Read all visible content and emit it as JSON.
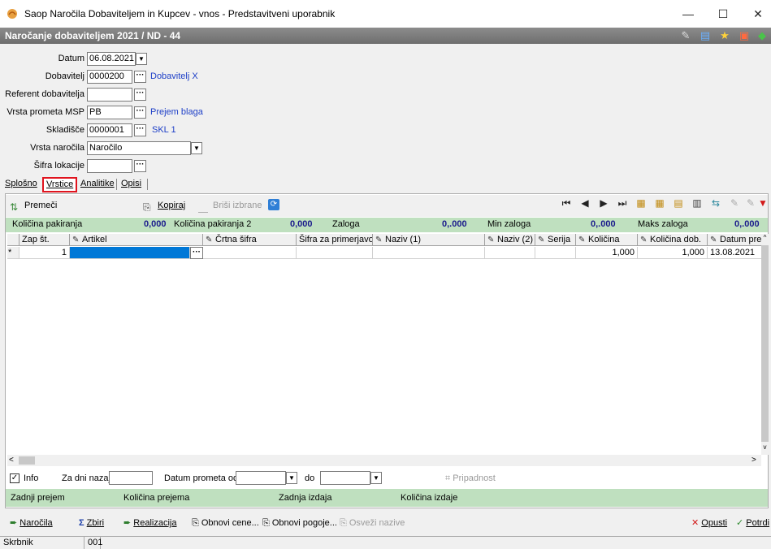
{
  "window": {
    "title": "Saop  Naročila Dobaviteljem in Kupcev - vnos - Predstavitveni uporabnik",
    "minimize": "—",
    "maximize": "☐",
    "close": "✕"
  },
  "header": {
    "title": "Naročanje dobaviteljem 2021 / ND - 44"
  },
  "form": {
    "datum_label": "Datum",
    "datum_value": "06.08.2021",
    "dobavitelj_label": "Dobavitelj",
    "dobavitelj_value": "0000200",
    "dobavitelj_name": "Dobavitelj X",
    "referent_label": "Referent dobavitelja",
    "referent_value": "",
    "vrsta_prometa_label": "Vrsta prometa MSP",
    "vrsta_prometa_value": "PB",
    "vrsta_prometa_name": "Prejem blaga",
    "skladisce_label": "Skladišče",
    "skladisce_value": "0000001",
    "skladisce_name": "SKL 1",
    "vrsta_narocila_label": "Vrsta naročila",
    "vrsta_narocila_value": "Naročilo",
    "sifra_lokacije_label": "Šifra lokacije",
    "sifra_lokacije_value": ""
  },
  "tabs": [
    {
      "label": "Splošno"
    },
    {
      "label": "Vrstice"
    },
    {
      "label": "Analitike"
    },
    {
      "label": "Opisi"
    }
  ],
  "toolbar": {
    "premeci": "Premeči",
    "kopiraj": "Kopiraj",
    "brisi": "Briši izbrane"
  },
  "stats": {
    "kolicina_pakiranja_label": "Količina pakiranja",
    "kolicina_pakiranja_value": "0,000",
    "kolicina_pakiranja2_label": "Količina pakiranja 2",
    "kolicina_pakiranja2_value": "0,000",
    "zaloga_label": "Zaloga",
    "zaloga_value": "0,.000",
    "min_zaloga_label": "Min zaloga",
    "min_zaloga_value": "0,.000",
    "maks_zaloga_label": "Maks zaloga",
    "maks_zaloga_value": "0,.000"
  },
  "grid": {
    "columns": [
      "Zap št.",
      "Artikel",
      "Črtna šifra",
      "Šifra za primerjavo",
      "Naziv (1)",
      "Naziv (2)",
      "Serija",
      "Količina",
      "Količina dob.",
      "Datum pre"
    ],
    "row": {
      "marker": "*",
      "zap": "1",
      "artikel": "",
      "crtna": "",
      "sifra_prim": "",
      "naziv1": "",
      "naziv2": "",
      "serija": "",
      "kolicina": "1,000",
      "kolicina_dob": "1,000",
      "datum": "13.08.2021"
    }
  },
  "filters": {
    "info_label": "Info",
    "info_checked": "✓",
    "za_dni_label": "Za dni nazaj",
    "datum_od_label": "Datum prometa od",
    "do_label": "do",
    "pripadnost": "Pripadnost"
  },
  "green2": {
    "zadnji_prejem": "Zadnji prejem",
    "kolicina_prejema": "Količina prejema",
    "zadnja_izdaja": "Zadnja izdaja",
    "kolicina_izdaje": "Količina izdaje"
  },
  "buttons": {
    "narocila": "Naročila",
    "zbiri": "Zbiri",
    "realizacija": "Realizacija",
    "obnovi_cene": "Obnovi cene...",
    "obnovi_pogoje": "Obnovi pogoje...",
    "osvezi": "Osveži nazive",
    "opusti": "Opusti",
    "potrdi": "Potrdi"
  },
  "status": {
    "label": "Skrbnik",
    "value": "001"
  },
  "colors": {
    "highlight_tab_border": "#e0141e",
    "green_band": "#bfe0bf",
    "selected_cell": "#0078d7",
    "link": "#1c3ec7"
  }
}
